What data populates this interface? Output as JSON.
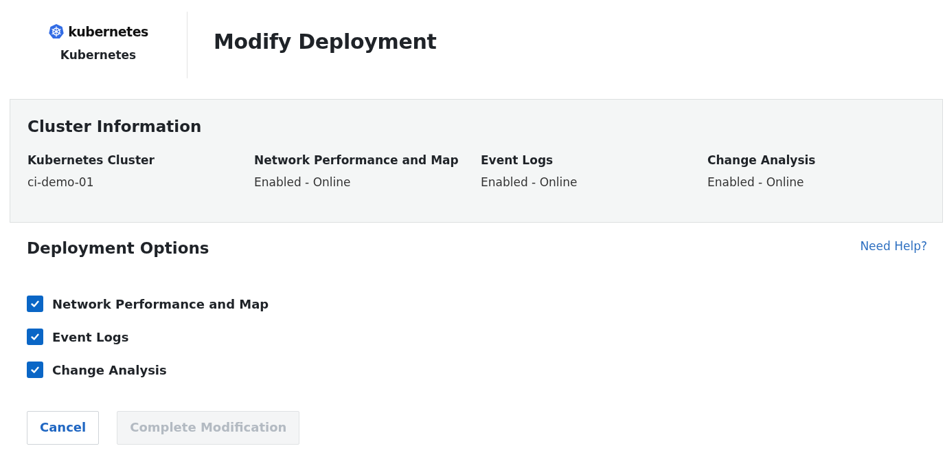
{
  "brand": {
    "logo_text": "kubernetes",
    "name": "Kubernetes"
  },
  "title": "Modify Deployment",
  "cluster_info": {
    "heading": "Cluster Information",
    "fields": [
      {
        "label": "Kubernetes Cluster",
        "value": "ci-demo-01"
      },
      {
        "label": "Network Performance and Map",
        "value": "Enabled - Online"
      },
      {
        "label": "Event Logs",
        "value": "Enabled - Online"
      },
      {
        "label": "Change Analysis",
        "value": "Enabled - Online"
      }
    ]
  },
  "deployment_options": {
    "heading": "Deployment Options",
    "help_link": "Need Help?",
    "options": [
      {
        "label": "Network Performance and Map",
        "checked": true
      },
      {
        "label": "Event Logs",
        "checked": true
      },
      {
        "label": "Change Analysis",
        "checked": true
      }
    ]
  },
  "buttons": [
    {
      "label": "Cancel",
      "disabled": false
    },
    {
      "label": "Complete Modification",
      "disabled": true
    }
  ]
}
